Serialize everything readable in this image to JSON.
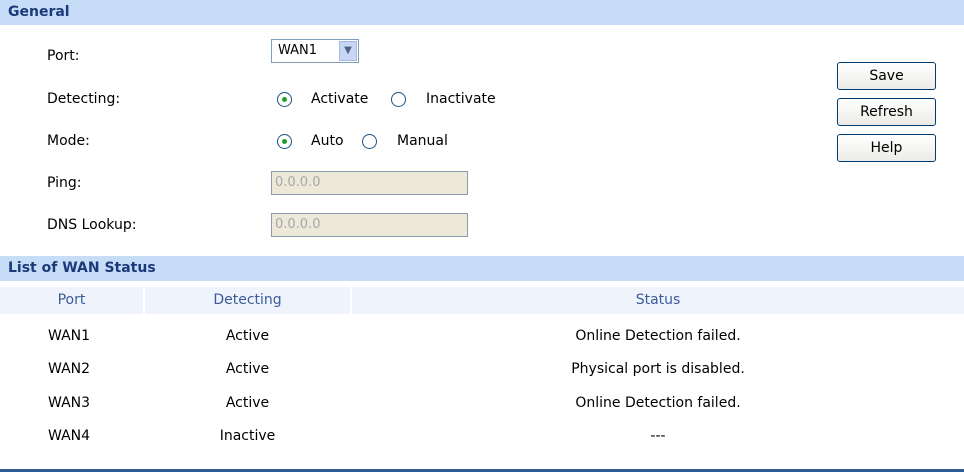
{
  "general": {
    "title": "General",
    "port_label": "Port:",
    "port_value": "WAN1",
    "detecting_label": "Detecting:",
    "detecting_options": [
      "Activate",
      "Inactivate"
    ],
    "detecting_selected": "Activate",
    "mode_label": "Mode:",
    "mode_options": [
      "Auto",
      "Manual"
    ],
    "mode_selected": "Auto",
    "ping_label": "Ping:",
    "ping_value": "0.0.0.0",
    "dns_label": "DNS Lookup:",
    "dns_value": "0.0.0.0"
  },
  "buttons": {
    "save": "Save",
    "refresh": "Refresh",
    "help": "Help"
  },
  "wan_list": {
    "title": "List of WAN Status",
    "headers": [
      "Port",
      "Detecting",
      "Status"
    ],
    "rows": [
      [
        "WAN1",
        "Active",
        "Online Detection failed."
      ],
      [
        "WAN2",
        "Active",
        "Physical port is disabled."
      ],
      [
        "WAN3",
        "Active",
        "Online Detection failed."
      ],
      [
        "WAN4",
        "Inactive",
        "---"
      ]
    ]
  },
  "colors": {
    "section_header_bg": "#c6dcf7",
    "section_header_text": "#1a3a7a",
    "table_header_bg": "#eef3fc",
    "table_header_text": "#3b5c9a",
    "radio_dot": "#21a121",
    "bottom_rule": "#2f5a92"
  },
  "icons": {
    "dropdown": "chevron-down-icon"
  }
}
